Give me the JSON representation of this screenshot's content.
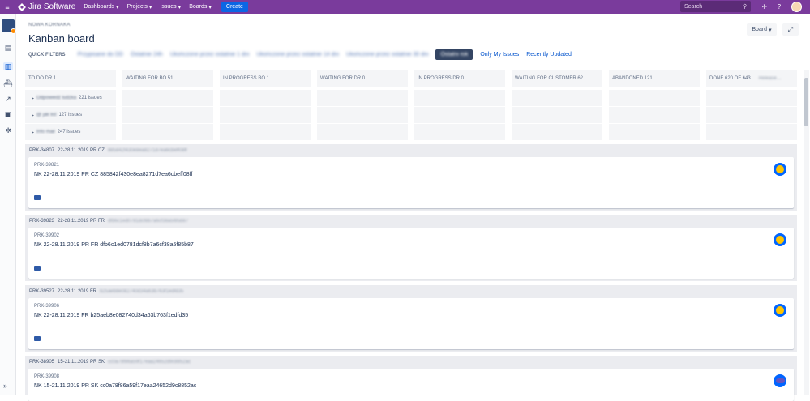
{
  "topnav": {
    "brand": "Jira Software",
    "menu": [
      {
        "label": "Dashboards"
      },
      {
        "label": "Projects"
      },
      {
        "label": "Issues"
      },
      {
        "label": "Boards"
      }
    ],
    "create_label": "Create",
    "search_placeholder": "Search",
    "accent": "#7a3b9c"
  },
  "header": {
    "breadcrumb": "NOWA KORNAKA",
    "title": "Kanban board",
    "board_button": "Board"
  },
  "quick_filters": {
    "label": "QUICK FILTERS:",
    "filters": [
      {
        "label": "Przypisane do DD",
        "blurred": true
      },
      {
        "label": "Ostatnie 24h",
        "blurred": true
      },
      {
        "label": "Ukończone przez ostatnie 1 dni",
        "blurred": true
      },
      {
        "label": "Ukończone przez ostatnie 14 dni",
        "blurred": true
      },
      {
        "label": "Ukończone przez ostatnie 30 dni",
        "blurred": true
      }
    ],
    "active_filter": "Ostatni rok",
    "my_issues": "Only My Issues",
    "recently_updated": "Recently Updated"
  },
  "columns": [
    {
      "label": "TO DO DR 1"
    },
    {
      "label": "WAITING FOR BO 51"
    },
    {
      "label": "IN PROGRESS BO 1"
    },
    {
      "label": "WAITING FOR DR 0"
    },
    {
      "label": "IN PROGRESS DR 0"
    },
    {
      "label": "WAITING FOR CUSTOMER 62"
    },
    {
      "label": "ABANDONED 121"
    },
    {
      "label": "DONE 620 OF 643"
    }
  ],
  "swimlanes": [
    {
      "name": "Odpowiedź ludzka",
      "count": "221 issues"
    },
    {
      "name": "@ jak list",
      "count": "127 issues"
    },
    {
      "name": "Info mail",
      "count": "247 issues"
    }
  ],
  "groups": [
    {
      "key": "PRK-34807",
      "title": "22-28.11.2019 PR CZ",
      "hash": "885842f430e8ea8271d7ea6cbeff08ff",
      "card": {
        "key": "PRK-39821",
        "summary": "NK 22-28.11.2019 PR CZ 885842f430e8ea8271d7ea6cbeff08ff",
        "avatar": "face"
      }
    },
    {
      "key": "PRK-39823",
      "title": "22-28.11.2019 PR FR",
      "hash": "dfb6c1ed0781dcf8b7a6cf38a5f85b87",
      "card": {
        "key": "PRK-39902",
        "summary": "NK 22-28.11.2019 PR FR dfb6c1ed0781dcf8b7a6cf38a5f85b87",
        "avatar": "cat"
      }
    },
    {
      "key": "PRK-39527",
      "title": "22-28.11.2019 FR",
      "hash": "b25aeb8e082740d34a63b763f1edfd35",
      "card": {
        "key": "PRK-39906",
        "summary": "NK 22-28.11.2019 FR b25aeb8e082740d34a63b763f1edfd35",
        "avatar": "cat"
      }
    },
    {
      "key": "PRK-38905",
      "title": "15-21.11.2019 PR SK",
      "hash": "cc0a78f86a59f17eaa24652d9c8852ac",
      "card": {
        "key": "PRK-39908",
        "summary": "NK 15-21.11.2019 PR SK cc0a78f86a59f17eaa24652d9c8852ac",
        "avatar": "glasses"
      }
    }
  ]
}
